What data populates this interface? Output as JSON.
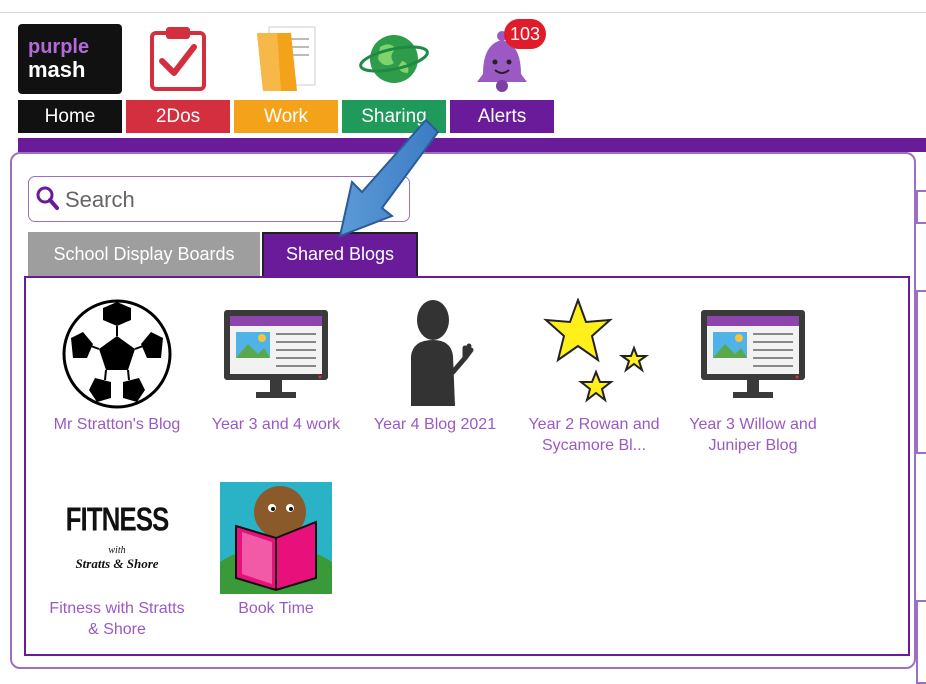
{
  "brand": {
    "line1": "purple",
    "line2": "mash"
  },
  "nav": {
    "items": [
      {
        "label": "Home",
        "color": "#111111",
        "icon": "purple-mash-logo"
      },
      {
        "label": "2Dos",
        "color": "#d32f3f",
        "icon": "clipboard-check-icon"
      },
      {
        "label": "Work",
        "color": "#f5a21b",
        "icon": "folder-icon"
      },
      {
        "label": "Sharing",
        "color": "#1f9a5a",
        "icon": "globe-icon"
      },
      {
        "label": "Alerts",
        "color": "#6a1b9a",
        "icon": "bell-icon"
      }
    ],
    "alerts_count": "103"
  },
  "search": {
    "placeholder": "Search",
    "value": ""
  },
  "tabs": [
    {
      "label": "School Display Boards",
      "active": false
    },
    {
      "label": "Shared Blogs",
      "active": true
    }
  ],
  "blogs": [
    {
      "title": "Mr Stratton's Blog",
      "icon": "football-icon"
    },
    {
      "title": "Year 3 and 4 work",
      "icon": "monitor-icon"
    },
    {
      "title": "Year 4 Blog 2021",
      "icon": "person-silhouette-icon"
    },
    {
      "title": "Year 2 Rowan and Sycamore Bl...",
      "icon": "stars-icon"
    },
    {
      "title": "Year 3 Willow and Juniper Blog",
      "icon": "monitor-icon"
    },
    {
      "title": "Fitness with Stratts & Shore",
      "icon": "fitness-logo",
      "logo_text": [
        "FITNESS",
        "with",
        "Stratts & Shore"
      ]
    },
    {
      "title": "Book Time",
      "icon": "reading-book-icon"
    }
  ],
  "colors": {
    "accent": "#6a1b9a",
    "caption": "#9b59c4",
    "border": "#9c6fc5"
  }
}
